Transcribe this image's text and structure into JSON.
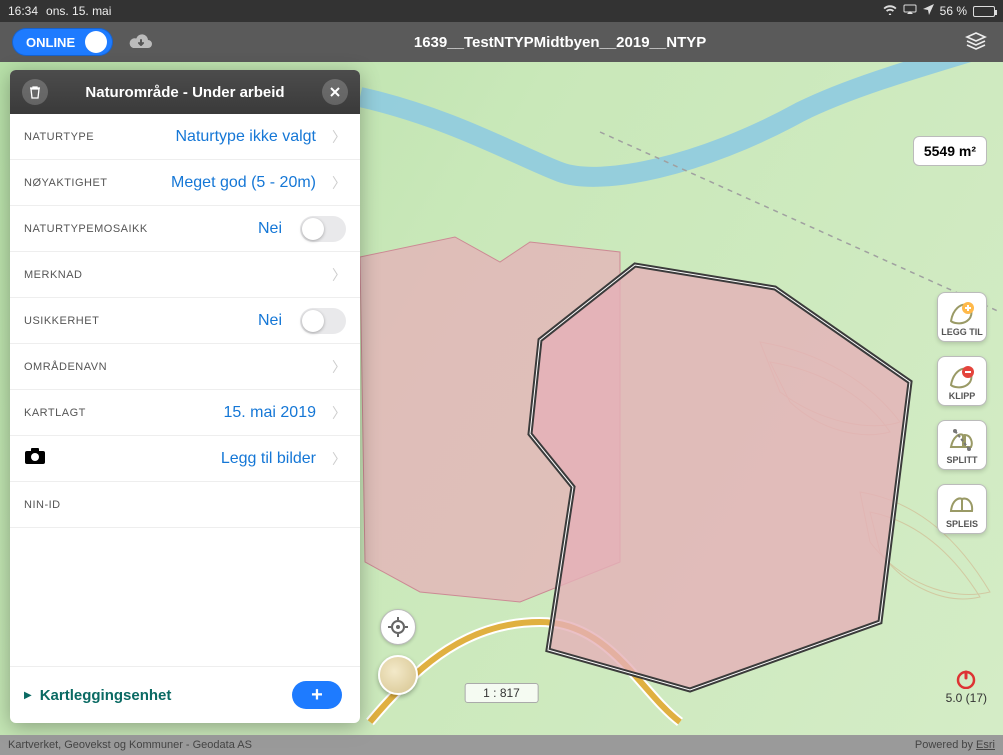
{
  "status": {
    "time": "16:34",
    "date": "ons. 15. mai",
    "battery_pct": "56 %",
    "icons": {
      "wifi": "wifi",
      "airplay": "airplay",
      "location": "location"
    }
  },
  "toolbar": {
    "online_label": "ONLINE",
    "title": "1639__TestNTYPMidtbyen__2019__NTYP"
  },
  "panel": {
    "title": "Naturområde - Under arbeid",
    "rows": {
      "naturtype_label": "NATURTYPE",
      "naturtype_value": "Naturtype ikke valgt",
      "noyaktighet_label": "NØYAKTIGHET",
      "noyaktighet_value": "Meget god (5 - 20m)",
      "mosaikk_label": "NATURTYPEMOSAIKK",
      "mosaikk_value": "Nei",
      "merknad_label": "MERKNAD",
      "usikkerhet_label": "USIKKERHET",
      "usikkerhet_value": "Nei",
      "omradenavn_label": "OMRÅDENAVN",
      "kartlagt_label": "KARTLAGT",
      "kartlagt_value": "15. mai 2019",
      "bilder_value": "Legg til bilder",
      "ninid_label": "NIN-ID"
    },
    "kartlegging_label": "Kartleggingsenhet"
  },
  "map": {
    "area_label": "5549 m²",
    "scale_label": "1 : 817",
    "gps_text": "5.0 (17)"
  },
  "tools": {
    "leggtil": "LEGG TIL",
    "klipp": "KLIPP",
    "splitt": "SPLITT",
    "spleis": "SPLEIS"
  },
  "attribution": {
    "left": "Kartverket, Geovekst og Kommuner - Geodata AS",
    "right_prefix": "Powered by ",
    "right_link": "Esri"
  }
}
